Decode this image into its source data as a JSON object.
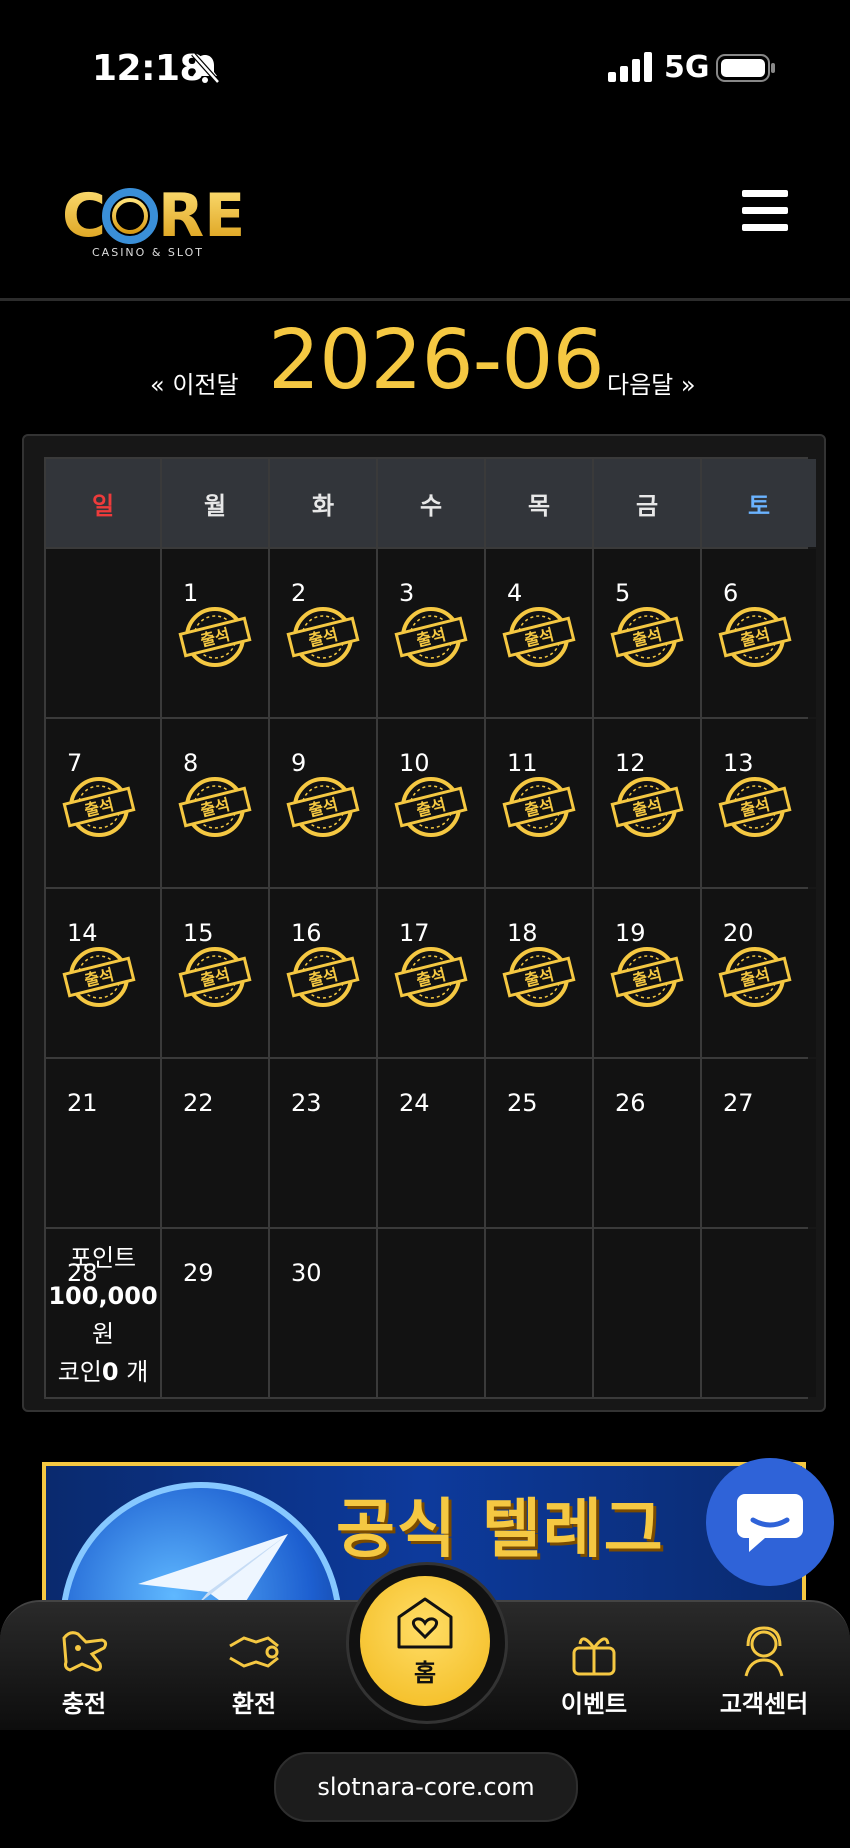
{
  "status_bar": {
    "time": "12:18",
    "network": "5G"
  },
  "header": {
    "logo_text": "CORE",
    "logo_sub": "CASINO & SLOT"
  },
  "month_nav": {
    "prev": "« 이전달",
    "title": "2026-06",
    "next": "다음달 »"
  },
  "calendar": {
    "weekdays": [
      "일",
      "월",
      "화",
      "수",
      "목",
      "금",
      "토"
    ],
    "stamp_label": "출석",
    "weeks": [
      [
        null,
        1,
        2,
        3,
        4,
        5,
        6
      ],
      [
        7,
        8,
        9,
        10,
        11,
        12,
        13
      ],
      [
        14,
        15,
        16,
        17,
        18,
        19,
        20
      ],
      [
        21,
        22,
        23,
        24,
        25,
        26,
        27
      ],
      [
        28,
        29,
        30,
        null,
        null,
        null,
        null
      ]
    ],
    "attended_days": [
      1,
      2,
      3,
      4,
      5,
      6,
      7,
      8,
      9,
      10,
      11,
      12,
      13,
      14,
      15,
      16,
      17,
      18,
      19,
      20
    ]
  },
  "points": {
    "label": "포인트",
    "value": "100,000",
    "unit": "원",
    "coin_label": "코인",
    "coin_value": "0",
    "coin_unit": "개"
  },
  "banner": {
    "title": "공식 텔레그"
  },
  "bottom_nav": {
    "charge": "충전",
    "exchange": "환전",
    "home": "홈",
    "event": "이벤트",
    "support": "고객센터"
  },
  "url_bar": {
    "url": "slotnara-core.com"
  },
  "colors": {
    "accent": "#f5c842",
    "sunday": "#ee3b3b",
    "saturday": "#6bb3ff",
    "chat": "#2f63d8"
  }
}
